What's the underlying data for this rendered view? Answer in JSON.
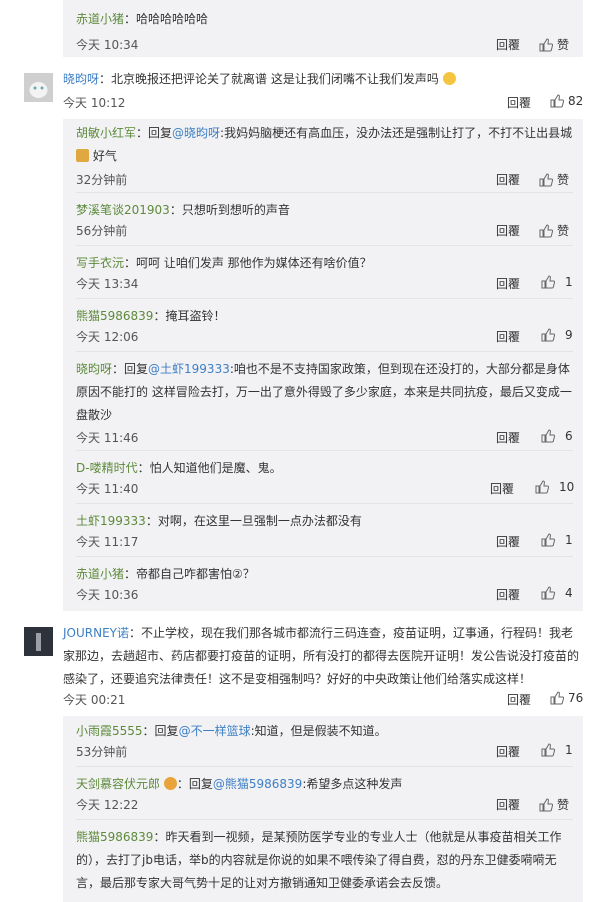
{
  "c0": {
    "user": "赤道小猪",
    "sep": "：",
    "text": "哈哈哈哈哈哈",
    "time": "今天 10:34",
    "reply": "回覆",
    "like": "赞"
  },
  "c1": {
    "user": "晓昀呀",
    "sep": "：",
    "text": "北京晚报还把评论关了就离谱 这是让我们闭嘴不让我们发声吗",
    "time": "今天 10:12",
    "reply": "回覆",
    "likes": "82"
  },
  "r1": {
    "user": "胡敏小红军",
    "pre": "：回复",
    "at": "@晓昀呀",
    "text": ":我妈妈脑梗还有高血压，没办法还是强制让打了，不打不让出县城",
    "text2": "好气",
    "time": "32分钟前",
    "reply": "回覆",
    "like": "赞"
  },
  "r2": {
    "user": "梦溪笔谈201903",
    "sep": "：",
    "text": "只想听到想听的声音",
    "time": "56分钟前",
    "reply": "回覆",
    "like": "赞"
  },
  "r3": {
    "user": "写手衣沅",
    "sep": "：",
    "text": "呵呵 让咱们发声 那他作为媒体还有啥价值？",
    "time": "今天 13:34",
    "reply": "回覆",
    "likes": "1"
  },
  "r4": {
    "user": "熊猫5986839",
    "sep": "：",
    "text": "掩耳盗铃！",
    "time": "今天 12:06",
    "reply": "回覆",
    "likes": "9"
  },
  "r5": {
    "user": "晓昀呀",
    "pre": "：回复",
    "at": "@土虾199333",
    "text": ":咱也不是不支持国家政策，但到现在还没打的，大部分都是身体原因不能打的 这样冒险去打，万一出了意外得毁了多少家庭，本来是共同抗疫，最后又变成一盘散沙",
    "time": "今天 11:46",
    "reply": "回覆",
    "likes": "6"
  },
  "r6": {
    "user": "D-喽精时代",
    "sep": "：",
    "text": "怕人知道他们是魔、鬼。",
    "time": "今天 11:40",
    "reply": "回覆",
    "likes": "10"
  },
  "r7": {
    "user": "土虾199333",
    "sep": "：",
    "text": "对啊，在这里一旦强制一点办法都没有",
    "time": "今天 11:17",
    "reply": "回覆",
    "likes": "1"
  },
  "r8": {
    "user": "赤道小猪",
    "sep": "：",
    "text": "帝都自己咋都害怕②？",
    "time": "今天 10:36",
    "reply": "回覆",
    "likes": "4"
  },
  "c2": {
    "user": "JOURNEY诺",
    "sep": "：",
    "text": "不止学校，现在我们那各城市都流行三码连查，疫苗证明，辽事通，行程码！我老家那边，去趟超市、药店都要打疫苗的证明，所有没打的都得去医院开证明！发公告说没打疫苗的感染了，还要追究法律责任！这不是变相强制吗？好好的中央政策让他们给落实成这样！",
    "time": "今天 00:21",
    "reply": "回覆",
    "likes": "76"
  },
  "r9": {
    "user": "小雨霞5555",
    "pre": "：回复",
    "at": "@不一样篮球",
    "text": ":知道，但是假装不知道。",
    "time": "53分钟前",
    "reply": "回覆",
    "likes": "1"
  },
  "r10": {
    "user": "天剑慕容伏元郎",
    "pre": "：回复",
    "at": "@熊猫5986839",
    "text": ":希望多点这种发声",
    "time": "今天 12:22",
    "reply": "回覆",
    "like": "赞"
  },
  "r11": {
    "user": "熊猫5986839",
    "sep": "：",
    "text": "昨天看到一视频，是某预防医学专业的专业人士（他就是从事疫苗相关工作的），去打了jb电话，举b的内容就是你说的如果不喂传染了得自费，怼的丹东卫健委嗬嗬无言，最后那专家大哥气势十足的让对方撤销通知卫健委承诺会去反馈。",
    "time": "",
    "reply": "",
    "like": ""
  }
}
